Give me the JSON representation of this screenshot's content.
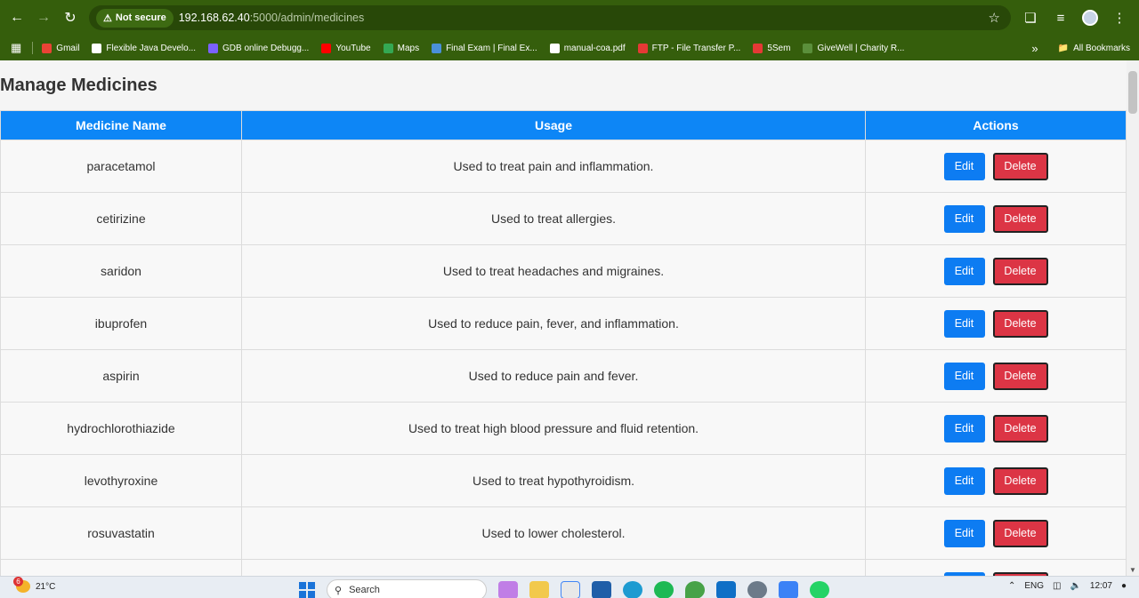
{
  "browser": {
    "security_label": "Not secure",
    "url_host": "192.168.62.40",
    "url_path": ":5000/admin/medicines",
    "bookmarks": [
      {
        "label": "Gmail",
        "color": "#ea4335"
      },
      {
        "label": "Flexible Java Develo...",
        "color": "#ffffff"
      },
      {
        "label": "GDB online Debugg...",
        "color": "#7b61ff"
      },
      {
        "label": "YouTube",
        "color": "#ff0000"
      },
      {
        "label": "Maps",
        "color": "#34a853"
      },
      {
        "label": "Final Exam | Final Ex...",
        "color": "#4a90d9"
      },
      {
        "label": "manual-coa.pdf",
        "color": "#ffffff"
      },
      {
        "label": "FTP - File Transfer P...",
        "color": "#e53935"
      },
      {
        "label": "5Sem",
        "color": "#e53935"
      },
      {
        "label": "GiveWell | Charity R...",
        "color": "#5b8f3b"
      }
    ],
    "all_bookmarks_label": "All Bookmarks"
  },
  "page": {
    "title": "Manage Medicines",
    "columns": [
      "Medicine Name",
      "Usage",
      "Actions"
    ],
    "edit_label": "Edit",
    "delete_label": "Delete",
    "rows": [
      {
        "name": "paracetamol",
        "usage": "Used to treat pain and inflammation."
      },
      {
        "name": "cetirizine",
        "usage": "Used to treat allergies."
      },
      {
        "name": "saridon",
        "usage": "Used to treat headaches and migraines."
      },
      {
        "name": "ibuprofen",
        "usage": "Used to reduce pain, fever, and inflammation."
      },
      {
        "name": "aspirin",
        "usage": "Used to reduce pain and fever."
      },
      {
        "name": "hydrochlorothiazide",
        "usage": "Used to treat high blood pressure and fluid retention."
      },
      {
        "name": "levothyroxine",
        "usage": "Used to treat hypothyroidism."
      },
      {
        "name": "rosuvastatin",
        "usage": "Used to lower cholesterol."
      },
      {
        "name": "",
        "usage": ""
      }
    ],
    "colors": {
      "header": "#0d86f6",
      "edit": "#0d7cf2",
      "delete": "#dc3545"
    }
  },
  "taskbar": {
    "weather_badge": "6",
    "temperature": "21°C",
    "search_placeholder": "Search",
    "language": "ENG",
    "time": "12:07"
  }
}
